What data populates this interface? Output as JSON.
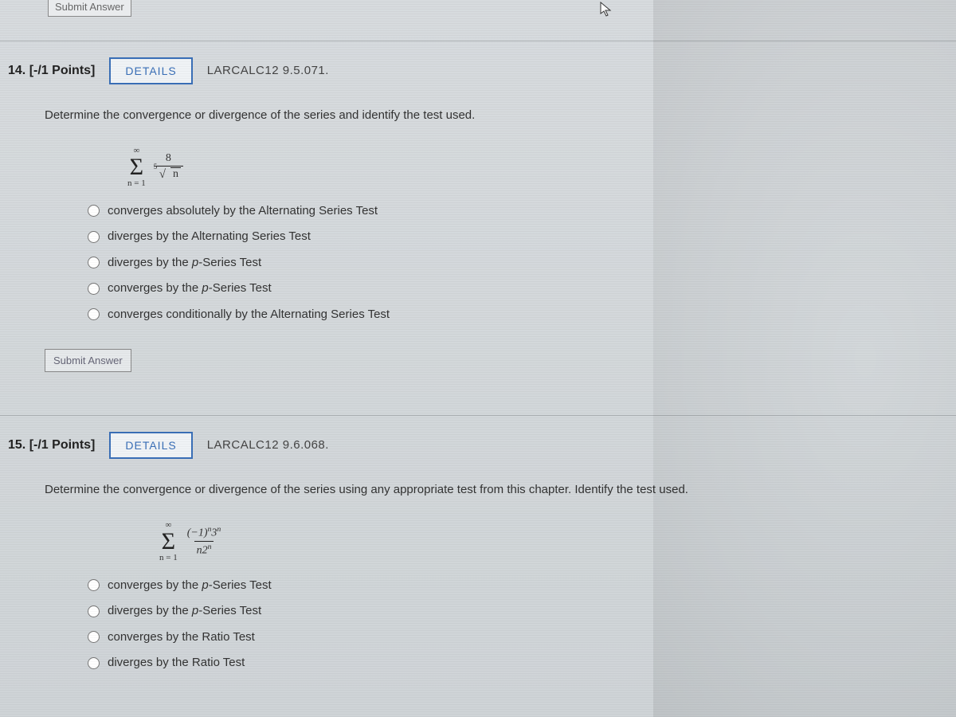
{
  "top_submit_label": "Submit Answer",
  "q14": {
    "number_label": "14.",
    "points_label": "[-/1 Points]",
    "details_label": "DETAILS",
    "source_ref": "LARCALC12 9.5.071.",
    "prompt": "Determine the convergence or divergence of the series and identify the test used.",
    "sigma": {
      "top": "∞",
      "bottom": "n = 1"
    },
    "frac": {
      "num": "8",
      "root_index": "5",
      "radicand": "n"
    },
    "options": [
      {
        "text": "converges absolutely by the Alternating Series Test"
      },
      {
        "text_before": "diverges by the Alternating Series Test"
      },
      {
        "text_before": "diverges by the ",
        "ital": "p",
        "text_after": "-Series Test"
      },
      {
        "text_before": "converges by the ",
        "ital": "p",
        "text_after": "-Series Test"
      },
      {
        "text_before": "converges conditionally by the Alternating Series Test"
      }
    ],
    "submit_label": "Submit Answer"
  },
  "q15": {
    "number_label": "15.",
    "points_label": "[-/1 Points]",
    "details_label": "DETAILS",
    "source_ref": "LARCALC12 9.6.068.",
    "prompt": "Determine the convergence or divergence of the series using any appropriate test from this chapter. Identify the test used.",
    "sigma": {
      "top": "∞",
      "bottom": "n = 1"
    },
    "frac": {
      "num_html": "(−1)ⁿ3ⁿ",
      "den_html": "n2ⁿ"
    },
    "options": [
      {
        "text_before": "converges by the ",
        "ital": "p",
        "text_after": "-Series Test"
      },
      {
        "text_before": "diverges by the ",
        "ital": "p",
        "text_after": "-Series Test"
      },
      {
        "text_before": "converges by the Ratio Test"
      },
      {
        "text_before": "diverges by the Ratio Test"
      }
    ]
  }
}
